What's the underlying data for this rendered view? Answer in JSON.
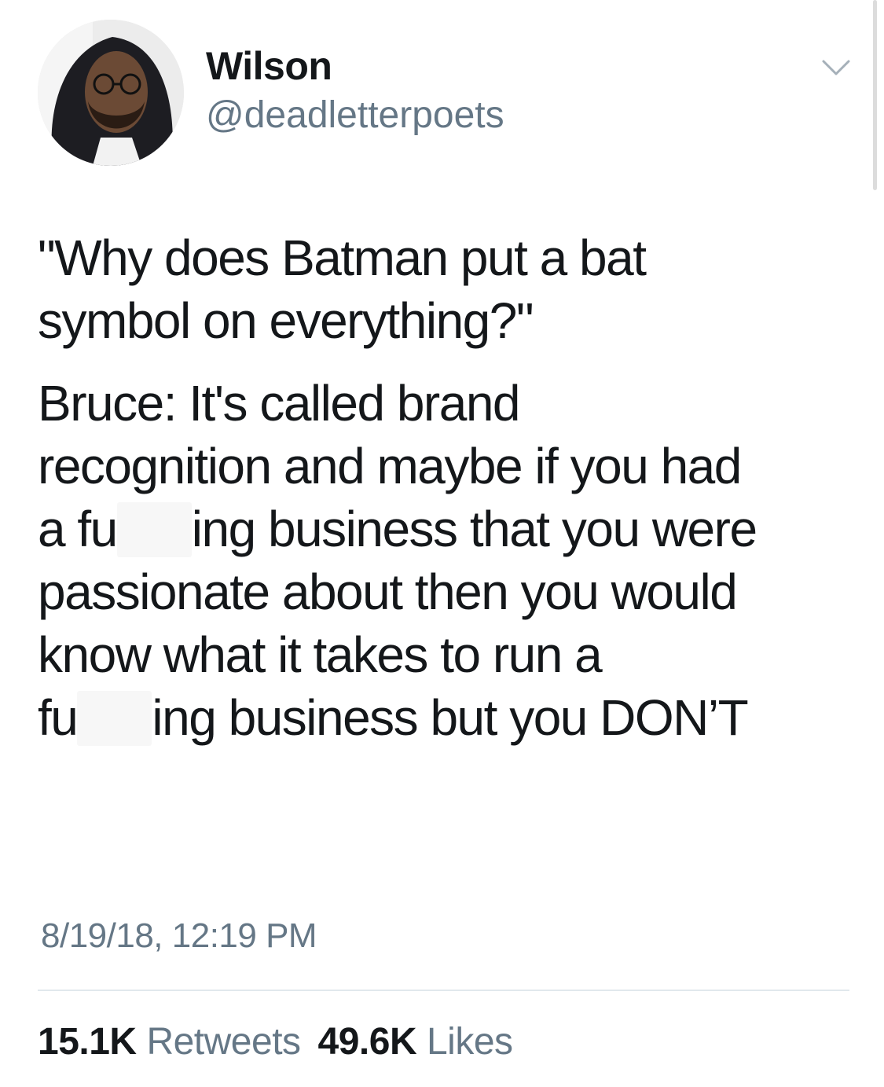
{
  "author": {
    "name": "Wilson",
    "handle": "@deadletterpoets"
  },
  "tweet": {
    "paragraphs": [
      [
        "\"Why does Batman put a bat",
        "symbol on everything?\""
      ],
      [
        "Bruce: It's called brand",
        "recognition and maybe if you had"
      ]
    ],
    "line5_pre": "a fu",
    "line5_post": "ing business that you were",
    "line6": "passionate about then you would",
    "line7": "know what it takes to run a",
    "line8_pre": "fu",
    "line8_post": "ing business but you DON’T"
  },
  "timestamp": "8/19/18, 12:19 PM",
  "stats": {
    "retweets_count": "15.1K",
    "retweets_label": "Retweets",
    "likes_count": "49.6K",
    "likes_label": "Likes"
  },
  "icons": {
    "menu": "chevron-down-icon"
  },
  "colors": {
    "text": "#14171a",
    "secondary": "#657786",
    "divider": "#e1e8ed",
    "censor": "#f7f7f7"
  }
}
